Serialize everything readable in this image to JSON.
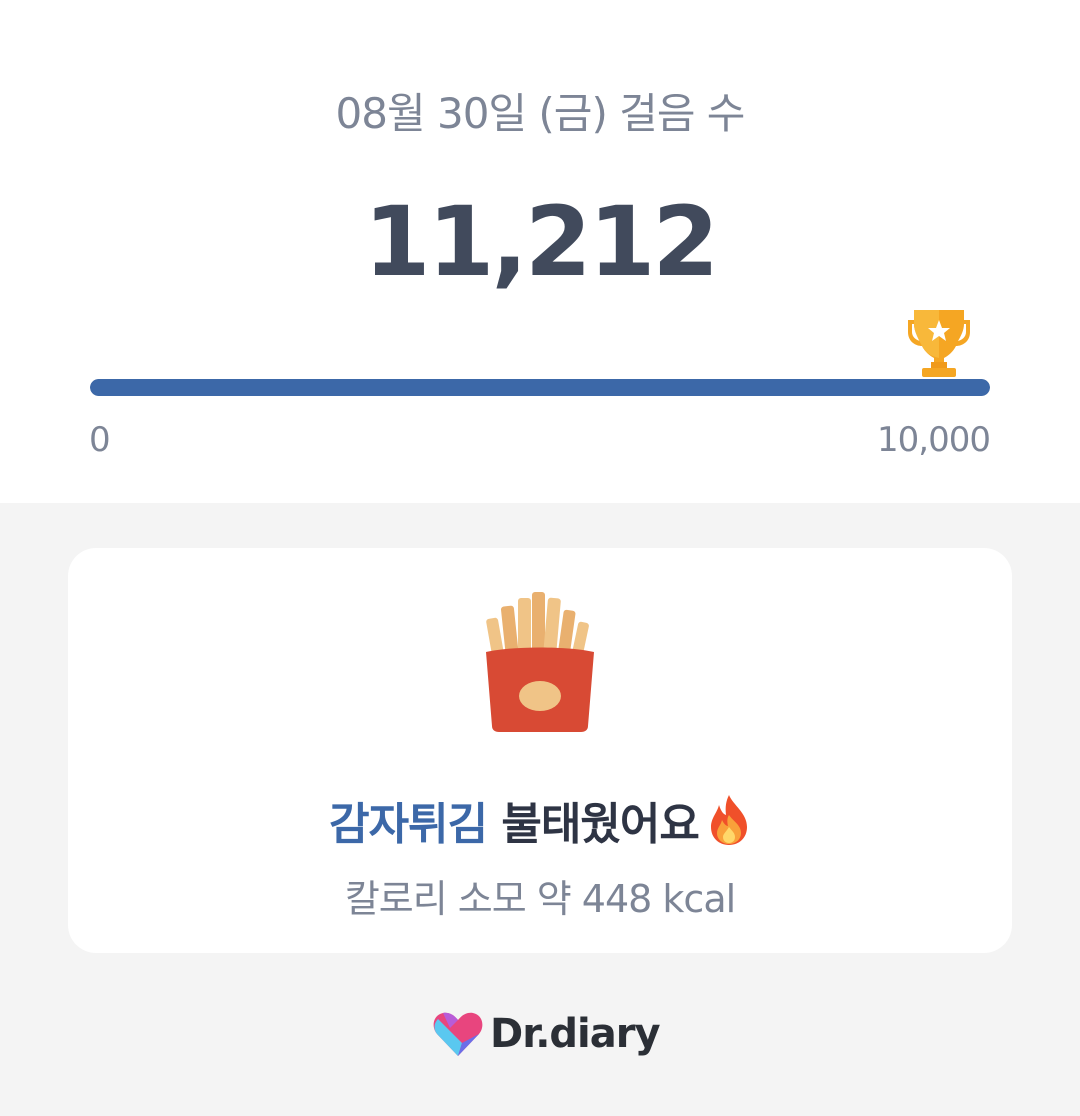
{
  "header": {
    "date_title": "08월 30일 (금) 걸음 수",
    "step_count": "11,212"
  },
  "progress": {
    "min_label": "0",
    "max_label": "10,000",
    "fraction": 1.0,
    "goal_icon": "trophy-icon",
    "fill_color": "#3c68a8"
  },
  "card": {
    "food_icon": "french-fries-icon",
    "food_name": "감자튀김",
    "burn_text": " 불태웠어요",
    "burn_icon": "fire-icon",
    "calorie_text": "칼로리 소모 약 448 kcal"
  },
  "brand": {
    "logo_icon": "heart-logo-icon",
    "name": "Dr.diary"
  }
}
